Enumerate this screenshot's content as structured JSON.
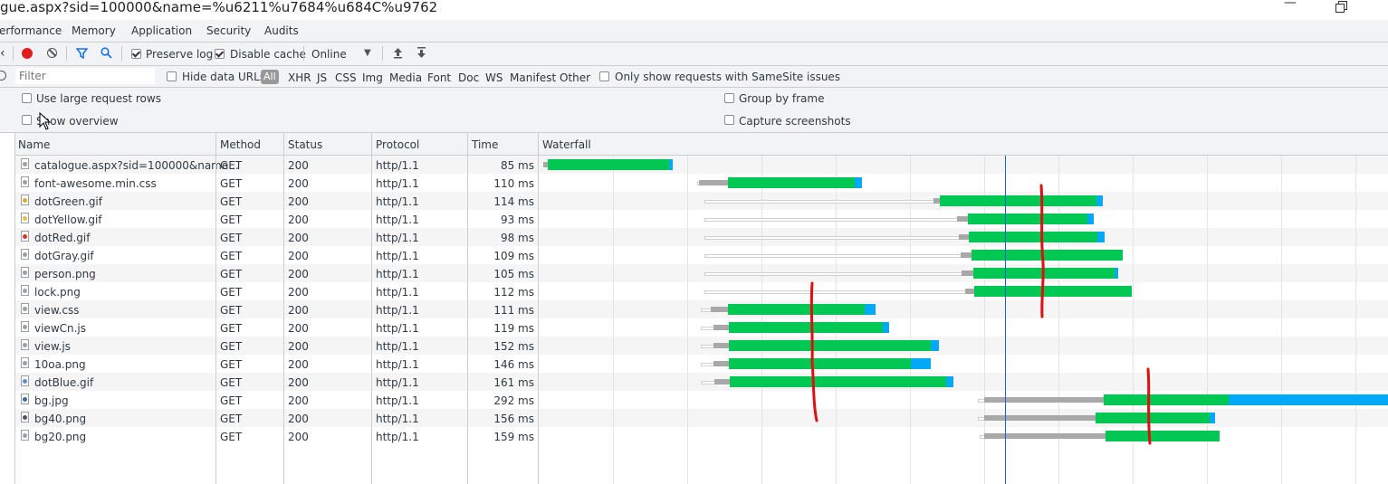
{
  "window": {
    "title": "gue.aspx?sid=100000&name=%u6211%u7684%u684C%u9762",
    "restore_icon": "restore-window-icon"
  },
  "tabs": [
    "erformance",
    "Memory",
    "Application",
    "Security",
    "Audits"
  ],
  "toolbar": {
    "record_icon": "record-icon",
    "clear_icon": "clear-icon",
    "filter_icon": "filter-icon",
    "search_icon": "search-icon",
    "preserve_log": "Preserve log",
    "disable_cache": "Disable cache",
    "throttle_value": "Online",
    "upload_icon": "import-har-icon",
    "download_icon": "export-har-icon"
  },
  "filterbar": {
    "placeholder": "Filter",
    "hide_data_urls": "Hide data URLs",
    "types": [
      "All",
      "XHR",
      "JS",
      "CSS",
      "Img",
      "Media",
      "Font",
      "Doc",
      "WS",
      "Manifest",
      "Other"
    ],
    "samesite": "Only show requests with SameSite issues"
  },
  "settings": {
    "large_rows": "Use large request rows",
    "show_overview": "Show overview",
    "group_by_frame": "Group by frame",
    "capture_screenshots": "Capture screenshots"
  },
  "columns": {
    "name": "Name",
    "method": "Method",
    "status": "Status",
    "protocol": "Protocol",
    "time": "Time",
    "waterfall": "Waterfall"
  },
  "colors": {
    "waiting": "#00c853",
    "download": "#03a9f4",
    "queue": "#a8a8a8",
    "marker": "#1a5fd6",
    "annotation": "#e01010"
  },
  "requests": [
    {
      "name": "catalogue.aspx?sid=100000&name...",
      "method": "GET",
      "status": "200",
      "protocol": "http/1.1",
      "time": "85 ms",
      "icon": "#9aa0a6"
    },
    {
      "name": "font-awesome.min.css",
      "method": "GET",
      "status": "200",
      "protocol": "http/1.1",
      "time": "110 ms",
      "icon": "#9aa0a6"
    },
    {
      "name": "dotGreen.gif",
      "method": "GET",
      "status": "200",
      "protocol": "http/1.1",
      "time": "114 ms",
      "icon": "#e8a53a"
    },
    {
      "name": "dotYellow.gif",
      "method": "GET",
      "status": "200",
      "protocol": "http/1.1",
      "time": "93 ms",
      "icon": "#e8c33a"
    },
    {
      "name": "dotRed.gif",
      "method": "GET",
      "status": "200",
      "protocol": "http/1.1",
      "time": "98 ms",
      "icon": "#d93025"
    },
    {
      "name": "dotGray.gif",
      "method": "GET",
      "status": "200",
      "protocol": "http/1.1",
      "time": "109 ms",
      "icon": "#9aa0a6"
    },
    {
      "name": "person.png",
      "method": "GET",
      "status": "200",
      "protocol": "http/1.1",
      "time": "105 ms",
      "icon": "#9aa0a6"
    },
    {
      "name": "lock.png",
      "method": "GET",
      "status": "200",
      "protocol": "http/1.1",
      "time": "112 ms",
      "icon": "#9aa0a6"
    },
    {
      "name": "view.css",
      "method": "GET",
      "status": "200",
      "protocol": "http/1.1",
      "time": "111 ms",
      "icon": "#9aa0a6"
    },
    {
      "name": "viewCn.js",
      "method": "GET",
      "status": "200",
      "protocol": "http/1.1",
      "time": "119 ms",
      "icon": "#9aa0a6"
    },
    {
      "name": "view.js",
      "method": "GET",
      "status": "200",
      "protocol": "http/1.1",
      "time": "152 ms",
      "icon": "#9aa0a6"
    },
    {
      "name": "10oa.png",
      "method": "GET",
      "status": "200",
      "protocol": "http/1.1",
      "time": "146 ms",
      "icon": "#9aa0a6"
    },
    {
      "name": "dotBlue.gif",
      "method": "GET",
      "status": "200",
      "protocol": "http/1.1",
      "time": "161 ms",
      "icon": "#5b8bd6"
    },
    {
      "name": "bg.jpg",
      "method": "GET",
      "status": "200",
      "protocol": "http/1.1",
      "time": "292 ms",
      "icon": "#3b6fb5"
    },
    {
      "name": "bg40.png",
      "method": "GET",
      "status": "200",
      "protocol": "http/1.1",
      "time": "156 ms",
      "icon": "#555555"
    },
    {
      "name": "bg20.png",
      "method": "GET",
      "status": "200",
      "protocol": "http/1.1",
      "time": "159 ms",
      "icon": "#9aa0a6"
    }
  ]
}
